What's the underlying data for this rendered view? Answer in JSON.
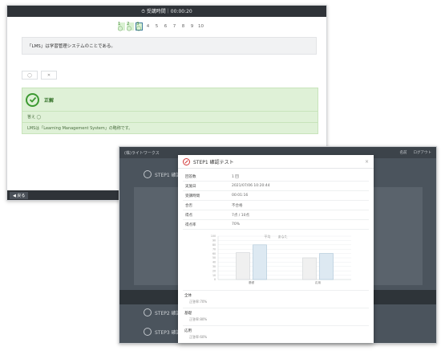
{
  "quiz": {
    "timer": "⏱ 受講時間｜00:00:20",
    "pager": [
      "1 ◯",
      "2 ◯",
      "3 ◯",
      "4",
      "5",
      "6",
      "7",
      "8",
      "9",
      "10"
    ],
    "question": "「LMS」は学習管理システムのことである。",
    "choices": [
      "◯",
      "✕"
    ],
    "result_title": "正解",
    "answer": "答え ◯",
    "explanation": "LMSは「Learning Management System」の略称です。",
    "back_label": "◀ 戻る"
  },
  "lms": {
    "logo": "(株)ライトワークス",
    "nav_right": [
      "名前",
      "ログアウト"
    ],
    "step1": "STEP1 確認テスト",
    "step2": "STEP2 確認テスト",
    "step3": "STEP3 確認テスト"
  },
  "modal": {
    "title": "STEP1 確認テスト",
    "close": "×",
    "rows": [
      {
        "k": "回答数",
        "v": "1 回"
      },
      {
        "k": "実施日",
        "v": "2021/07/06 10:20:44"
      },
      {
        "k": "受講時間",
        "v": "00:01:16"
      },
      {
        "k": "合否",
        "v": "不合格"
      },
      {
        "k": "得点",
        "v": "7点 / 10点"
      },
      {
        "k": "得点率",
        "v": "70%"
      }
    ],
    "legend": [
      "平均",
      "あなた"
    ],
    "sections": [
      {
        "title": "全体",
        "sub": "正答率:70%"
      },
      {
        "title": "基礎",
        "sub": "正答率:80%"
      },
      {
        "title": "応用",
        "sub": "正答率:60%"
      }
    ]
  },
  "chart_data": {
    "type": "bar",
    "categories": [
      "基礎",
      "応用"
    ],
    "series": [
      {
        "name": "平均",
        "values": [
          62,
          50
        ]
      },
      {
        "name": "あなた",
        "values": [
          80,
          60
        ]
      }
    ],
    "ylim": [
      0,
      100
    ],
    "yticks": [
      0,
      10,
      20,
      30,
      40,
      50,
      60,
      70,
      80,
      90,
      100
    ],
    "grid": true,
    "legend_position": "top",
    "colors": {
      "平均": "#f0f0f0",
      "あなた": "#dde9f2"
    }
  }
}
